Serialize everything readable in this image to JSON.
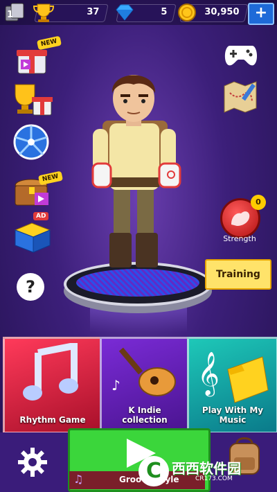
{
  "top_bar": {
    "level_label": "1",
    "trophies": "37",
    "gems": "5",
    "coins": "30,950",
    "plus_label": "+"
  },
  "side_menu": {
    "new_badge_1": "NEW",
    "new_badge_2": "NEW",
    "ad_badge": "AD",
    "help_label": "?"
  },
  "character": {
    "strength_label": "Strength",
    "strength_count": "0",
    "training_label": "Training"
  },
  "cards": [
    {
      "label": "Rhythm Game"
    },
    {
      "label": "K Indie collection"
    },
    {
      "label": "Play With My Music"
    }
  ],
  "bottom": {
    "song_title": "Groovy Style"
  },
  "watermark": {
    "text": "西西软件园",
    "sub": "CR173.COM"
  },
  "colors": {
    "accent_blue": "#1e6ad8",
    "play_green": "#3bd63b",
    "training_yellow": "#ffe36a"
  }
}
